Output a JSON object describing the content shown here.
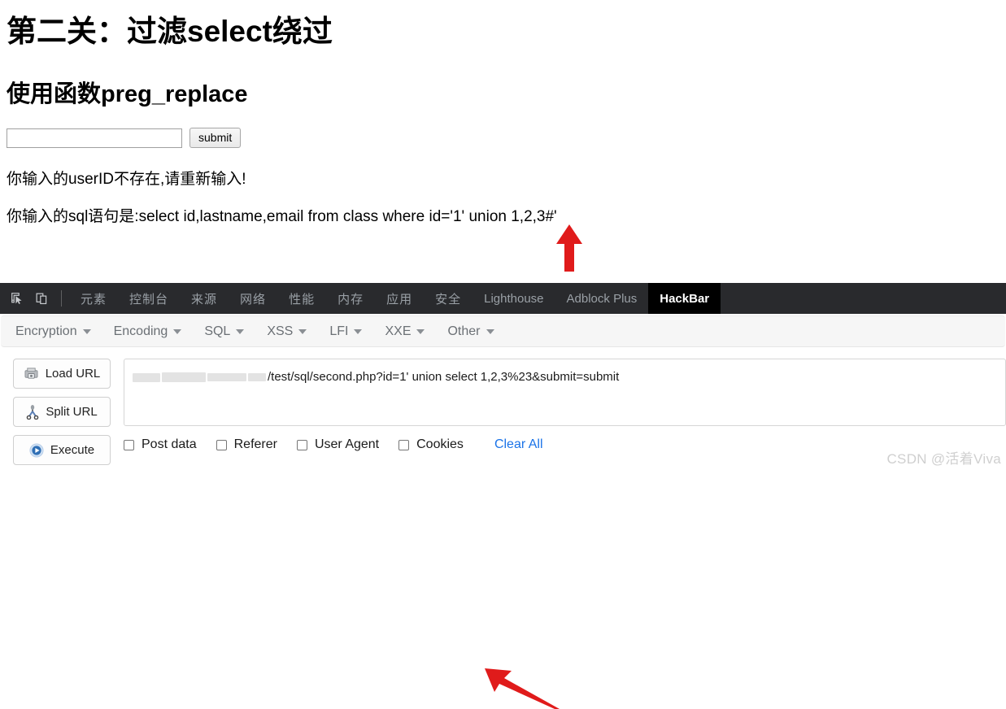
{
  "page": {
    "title": "第二关：过滤select绕过",
    "subtitle": "使用函数preg_replace",
    "input_value": "",
    "input_placeholder": "",
    "submit_label": "submit",
    "result_line_1": "你输入的userID不存在,请重新输入!",
    "result_line_2": "你输入的sql语句是:select id,lastname,email from class where id='1' union 1,2,3#'"
  },
  "devtools": {
    "icons": [
      "inspect-element-icon",
      "device-toolbar-icon"
    ],
    "tabs": [
      {
        "label": "元素",
        "active": false,
        "cn": true
      },
      {
        "label": "控制台",
        "active": false,
        "cn": true
      },
      {
        "label": "来源",
        "active": false,
        "cn": true
      },
      {
        "label": "网络",
        "active": false,
        "cn": true
      },
      {
        "label": "性能",
        "active": false,
        "cn": true
      },
      {
        "label": "内存",
        "active": false,
        "cn": true
      },
      {
        "label": "应用",
        "active": false,
        "cn": true
      },
      {
        "label": "安全",
        "active": false,
        "cn": true
      },
      {
        "label": "Lighthouse",
        "active": false,
        "cn": false
      },
      {
        "label": "Adblock Plus",
        "active": false,
        "cn": false
      },
      {
        "label": "HackBar",
        "active": true,
        "cn": false
      }
    ],
    "tabbar_bg": "#292a2d",
    "active_tab_bg": "#000000"
  },
  "hackbar": {
    "menus": [
      {
        "label": "Encryption"
      },
      {
        "label": "Encoding"
      },
      {
        "label": "SQL"
      },
      {
        "label": "XSS"
      },
      {
        "label": "LFI"
      },
      {
        "label": "XXE"
      },
      {
        "label": "Other"
      }
    ],
    "buttons": [
      {
        "label": "Load URL",
        "icon": "load-url-icon"
      },
      {
        "label": "Split URL",
        "icon": "split-url-icon"
      },
      {
        "label": "Execute",
        "icon": "execute-icon"
      }
    ],
    "url_value": "/test/sql/second.php?id=1' union select 1,2,3%23&submit=submit",
    "url_redacted_prefix": true,
    "options": [
      {
        "label": "Post data",
        "checked": false
      },
      {
        "label": "Referer",
        "checked": false
      },
      {
        "label": "User Agent",
        "checked": false
      },
      {
        "label": "Cookies",
        "checked": false
      }
    ],
    "clear_all_label": "Clear All",
    "link_color": "#1a73e8"
  },
  "annotations": {
    "arrow_color": "#e01b1b",
    "arrow_up_target": "1,2,3#'",
    "arrow_diag_target": "1,2,3%23&submit=submit"
  },
  "watermark": "CSDN @活着Viva"
}
